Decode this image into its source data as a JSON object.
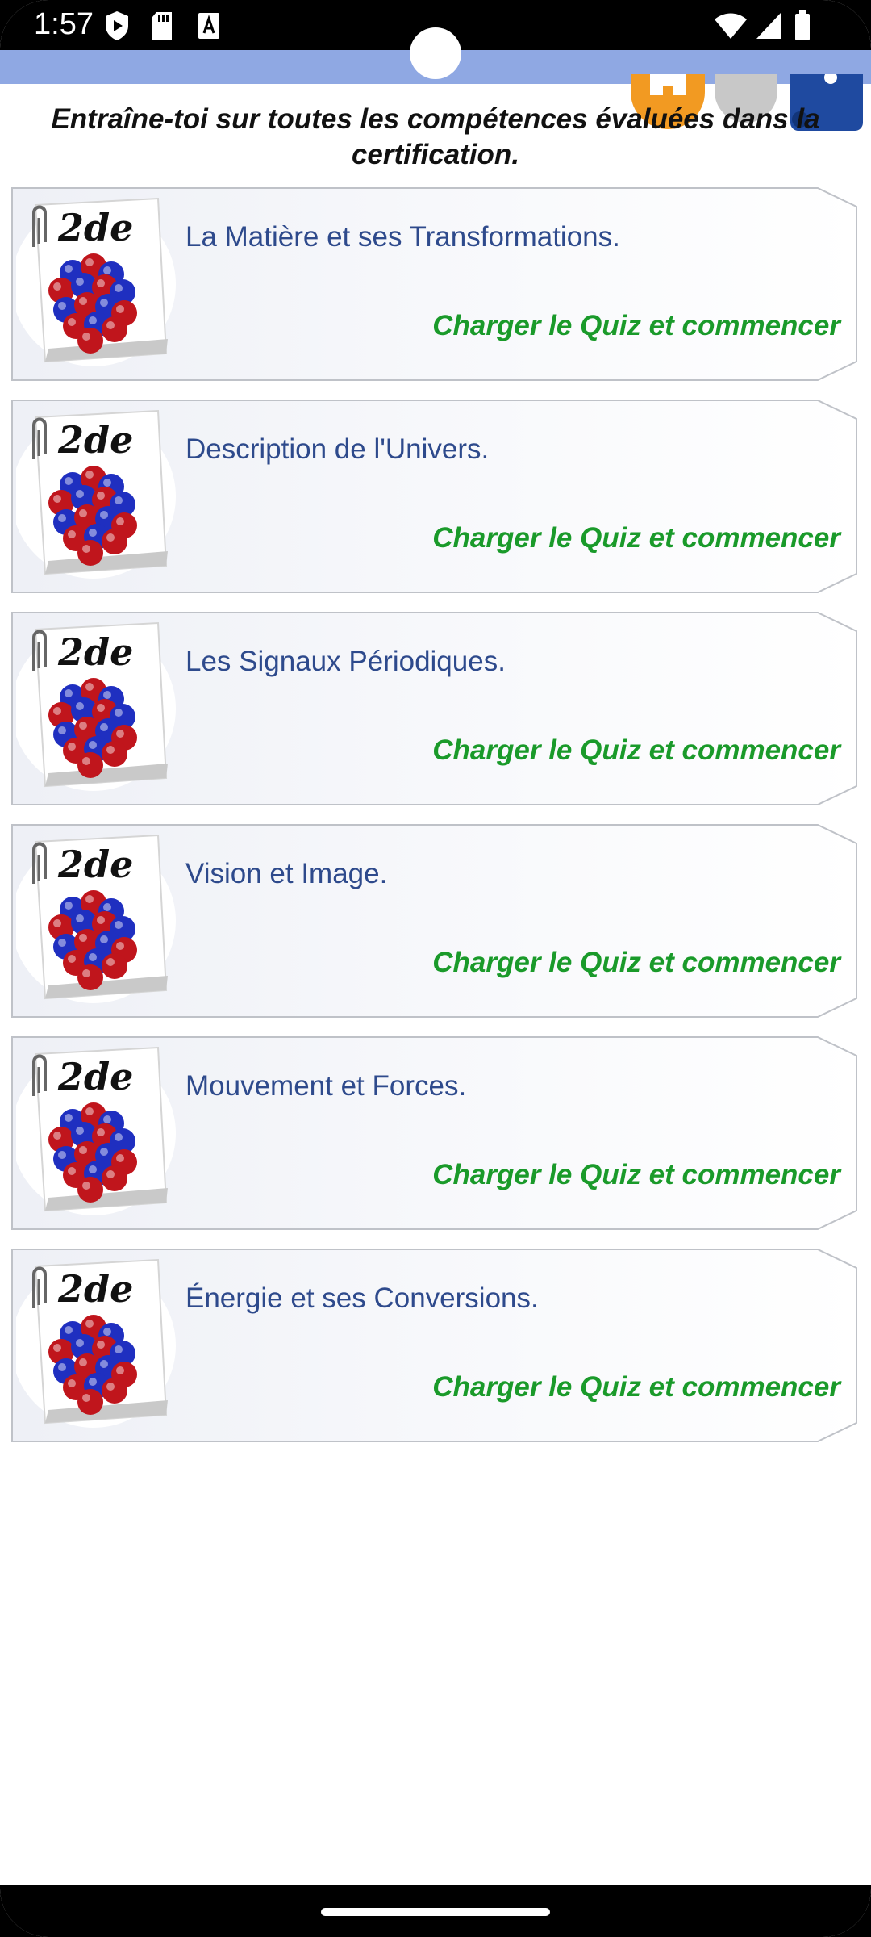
{
  "status_bar": {
    "time": "1:57",
    "left_icons": [
      "shield-play-icon",
      "sd-card-icon",
      "text-a-icon"
    ],
    "right_icons": [
      "wifi-icon",
      "signal-icon",
      "battery-icon"
    ]
  },
  "header": {
    "buttons": [
      "home-button",
      "profile-button",
      "menu-button"
    ]
  },
  "subtitle": "Entraîne-toi sur toutes les compétences évaluées dans la certification.",
  "logo_label": "2de",
  "quizzes": [
    {
      "title": "La Matière et ses Transformations.",
      "cta": "Charger le Quiz et commencer"
    },
    {
      "title": "Description de l'Univers.",
      "cta": "Charger le Quiz et commencer"
    },
    {
      "title": "Les Signaux Périodiques.",
      "cta": "Charger le Quiz et commencer"
    },
    {
      "title": "Vision et Image.",
      "cta": "Charger le Quiz et commencer"
    },
    {
      "title": "Mouvement et Forces.",
      "cta": "Charger le Quiz et commencer"
    },
    {
      "title": "Énergie et ses Conversions.",
      "cta": "Charger le Quiz et commencer"
    }
  ],
  "colors": {
    "header_band": "#8fa8e3",
    "title_text": "#2e4a8c",
    "cta_text": "#1a9a2a",
    "atom_red": "#c0151c",
    "atom_blue": "#1f2fc0"
  }
}
